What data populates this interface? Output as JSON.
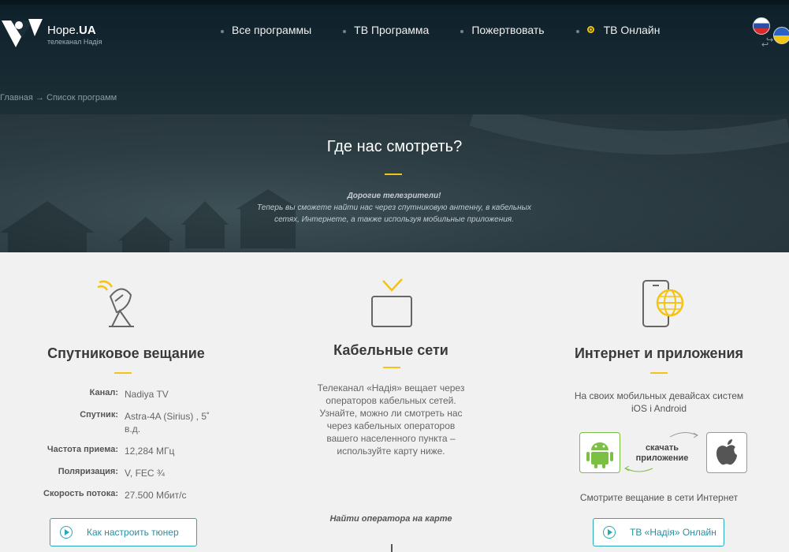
{
  "header": {
    "logo": {
      "title_main": "Hope.",
      "title_bold": "UA",
      "subtitle": "телеканал Надія"
    },
    "nav": [
      {
        "label": "Все программы"
      },
      {
        "label": "ТВ Программа"
      },
      {
        "label": "Пожертвовать"
      },
      {
        "label": "ТВ Онлайн"
      }
    ],
    "languages": [
      "ru",
      "ua"
    ]
  },
  "breadcrumb": {
    "home": "Главная",
    "separator": "→",
    "current": "Список программ"
  },
  "hero": {
    "title": "Где нас смотреть?",
    "text_bold": "Дорогие телезрители!",
    "text": "Теперь вы сможете найти нас через спутниковую антенну, в кабельных сетях, Интернете, а также используя мобильные приложения."
  },
  "satellite": {
    "title": "Спутниковое вещание",
    "rows": [
      {
        "label": "Канал:",
        "value": "Nadiya TV"
      },
      {
        "label": "Спутник:",
        "value": "Astra-4A (Sirius) , 5˚ в.д."
      },
      {
        "label": "Частота приема:",
        "value": "12,284 МГц"
      },
      {
        "label": "Поляризация:",
        "value": "V, FEC ¾"
      },
      {
        "label": "Скорость потока:",
        "value": "27.500 Мбит/с"
      }
    ],
    "button": "Как настроить тюнер"
  },
  "cable": {
    "title": "Кабельные сети",
    "text": "Телеканал «Надія» вещает через операторов кабельных сетей. Узнайте, можно ли смотреть нас через кабельных операторов вашего населенного пункта – используйте карту ниже.",
    "map_link": "Найти оператора на карте"
  },
  "internet": {
    "title": "Интернет и приложения",
    "text": "На своих мобильных девайсах систем iOS i Android",
    "download_label": "скачать приложение",
    "watch_text": "Смотрите вещание в сети Интернет",
    "button": "ТВ «Надія» Онлайн"
  },
  "colors": {
    "accent": "#f3c316",
    "teal": "#2aa7b8",
    "android": "#7ac043"
  }
}
